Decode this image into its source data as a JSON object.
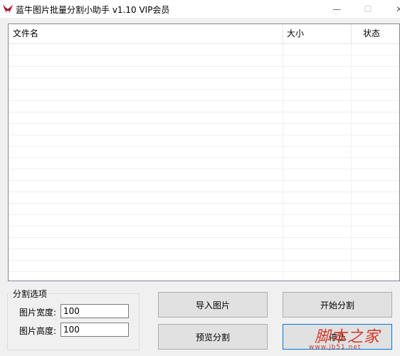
{
  "window": {
    "title": "蓝牛图片批量分割小助手 v1.10 VIP会员",
    "minimize_glyph": "—",
    "maximize_glyph": "☐",
    "close_glyph": "✕",
    "icon": "app-logo-icon"
  },
  "file_list": {
    "columns": [
      "文件名",
      "大小",
      "状态"
    ],
    "rows": []
  },
  "split_options": {
    "group_label": "分割选项",
    "width_label": "图片宽度:",
    "width_value": "100",
    "height_label": "图片高度:",
    "height_value": "100"
  },
  "buttons": {
    "import": "导入图片",
    "start": "开始分割",
    "preview": "预览分割",
    "stop": "停止"
  },
  "watermark": {
    "main": "脚本之家",
    "sub": "www.jb51.net"
  },
  "colors": {
    "accent": "#0078d7",
    "watermark": "#d23b2b",
    "icon_red": "#c8102e"
  }
}
